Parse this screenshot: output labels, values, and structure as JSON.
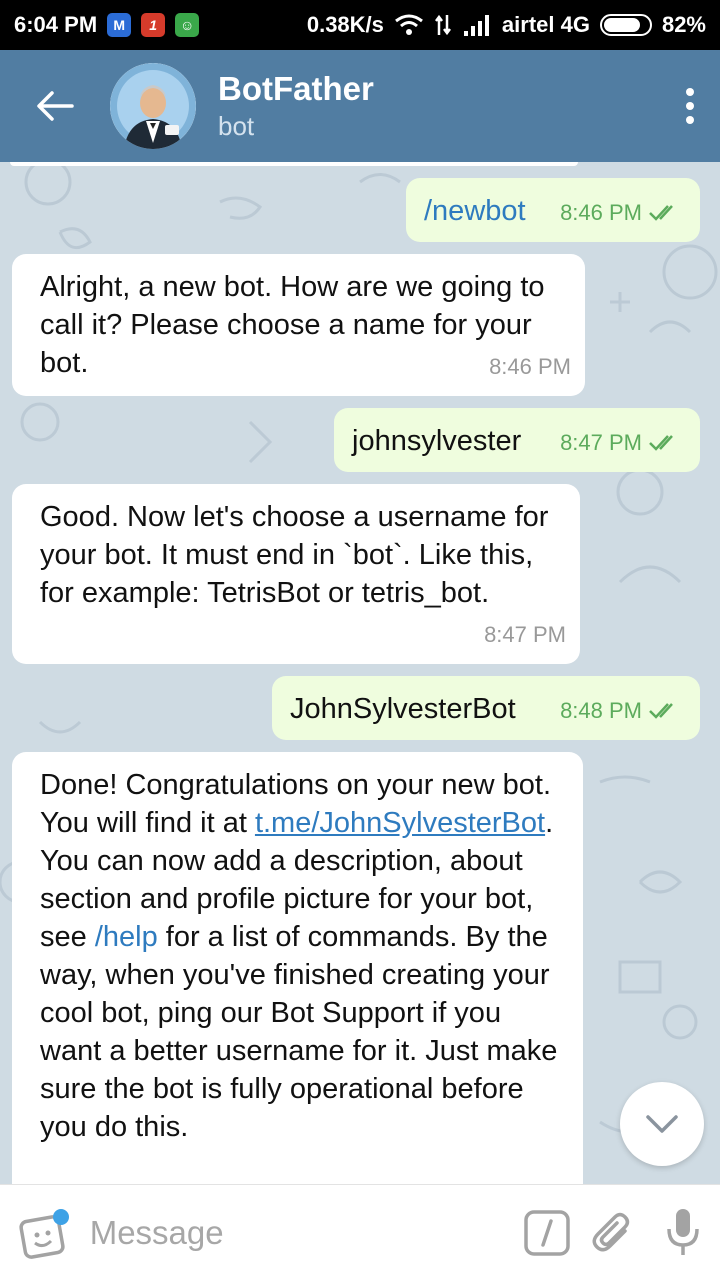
{
  "status_bar": {
    "time": "6:04 PM",
    "speed": "0.38K/s",
    "carrier": "airtel 4G",
    "battery": "82%",
    "battery_level": 0.82
  },
  "header": {
    "title": "BotFather",
    "subtitle": "bot"
  },
  "messages": [
    {
      "dir": "out",
      "text": "/newbot",
      "time": "8:46 PM"
    },
    {
      "dir": "in",
      "text": "Alright, a new bot. How are we going to call it? Please choose a name for your bot.",
      "time": "8:46 PM"
    },
    {
      "dir": "out",
      "text": "johnsylvester",
      "time": "8:47 PM"
    },
    {
      "dir": "in",
      "text": "Good. Now let's choose a username for your bot. It must end in `bot`. Like this, for example: TetrisBot or tetris_bot.",
      "time": "8:47 PM"
    },
    {
      "dir": "out",
      "text": "JohnSylvesterBot",
      "time": "8:48 PM"
    },
    {
      "dir": "in",
      "parts": {
        "p1": "Done! Congratulations on your new bot. You will find it at ",
        "link": "t.me/JohnSylvesterBot",
        "p2": ". You can now add a description, about section and profile picture for your bot, see ",
        "cmd": "/help",
        "p3": " for a list of commands. By the way, when you've finished creating your cool bot, ping our Bot Support if you want a better username for it. Just make sure the bot is fully operational before you do this."
      }
    }
  ],
  "input": {
    "placeholder": "Message"
  },
  "colors": {
    "header": "#517da2",
    "outgoing_bubble": "#effdde",
    "incoming_bubble": "#ffffff",
    "link": "#2e7bbf",
    "read_check": "#5cab5c"
  },
  "icons": {
    "back": "arrow-left-icon",
    "menu": "more-vertical-icon",
    "emoji": "sticker-icon",
    "commands": "slash-command-icon",
    "attach": "paperclip-icon",
    "mic": "microphone-icon",
    "scroll": "chevron-down-icon"
  }
}
